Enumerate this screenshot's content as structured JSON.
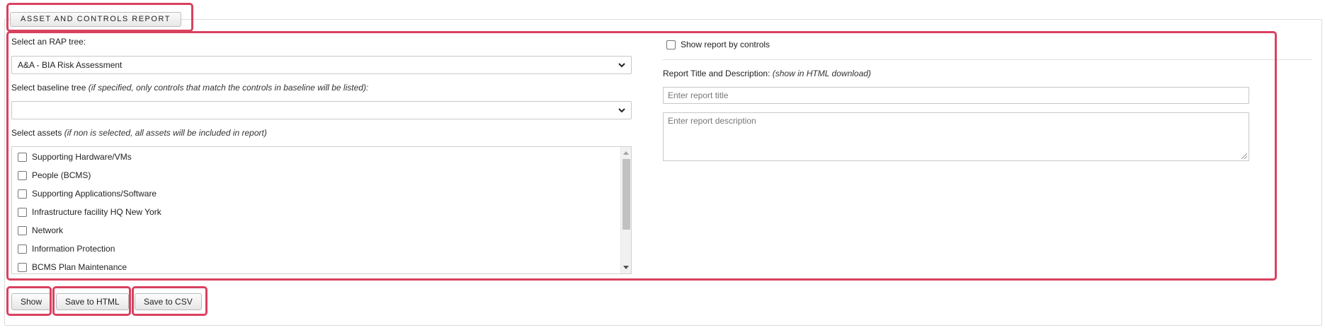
{
  "tab": {
    "label": "ASSET AND CONTROLS REPORT"
  },
  "form": {
    "rap_tree": {
      "label": "Select an RAP tree:",
      "selected": "A&A - BIA Risk Assessment"
    },
    "baseline_tree": {
      "label": "Select baseline tree",
      "hint": "(if specified, only controls that match the controls in baseline will be listed):",
      "selected": ""
    },
    "assets": {
      "label": "Select assets",
      "hint": "(if non is selected, all assets will be included in report)",
      "items": [
        {
          "label": "Supporting Hardware/VMs",
          "checked": false
        },
        {
          "label": "People (BCMS)",
          "checked": false
        },
        {
          "label": "Supporting Applications/Software",
          "checked": false
        },
        {
          "label": "Infrastructure facility HQ New York",
          "checked": false
        },
        {
          "label": "Network",
          "checked": false
        },
        {
          "label": "Information Protection",
          "checked": false
        },
        {
          "label": "BCMS Plan Maintenance",
          "checked": false
        }
      ]
    },
    "show_by_controls": {
      "label": "Show report by controls",
      "checked": false
    },
    "report": {
      "label": "Report Title and Description:",
      "hint": "(show in HTML download)",
      "title_placeholder": "Enter report title",
      "description_placeholder": "Enter report description"
    }
  },
  "buttons": {
    "show": "Show",
    "save_html": "Save to HTML",
    "save_csv": "Save to CSV"
  },
  "colors": {
    "highlight": "#d9415f",
    "border": "#dcdcdc"
  }
}
